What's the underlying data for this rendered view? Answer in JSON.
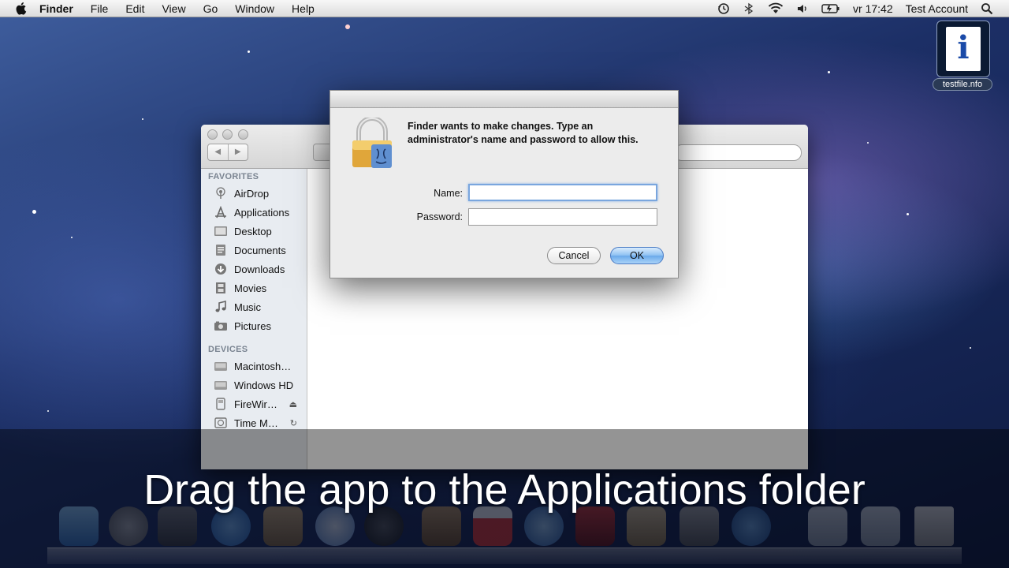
{
  "menubar": {
    "items": [
      "Finder",
      "File",
      "Edit",
      "View",
      "Go",
      "Window",
      "Help"
    ],
    "clock": "vr 17:42",
    "user": "Test Account"
  },
  "badge": {
    "label": "testfile.nfo"
  },
  "finder": {
    "sidebar": {
      "favorites_heading": "FAVORITES",
      "favorites": [
        {
          "label": "AirDrop",
          "icon": "airdrop-icon"
        },
        {
          "label": "Applications",
          "icon": "applications-icon"
        },
        {
          "label": "Desktop",
          "icon": "desktop-icon"
        },
        {
          "label": "Documents",
          "icon": "documents-icon"
        },
        {
          "label": "Downloads",
          "icon": "downloads-icon"
        },
        {
          "label": "Movies",
          "icon": "movies-icon"
        },
        {
          "label": "Music",
          "icon": "music-icon"
        },
        {
          "label": "Pictures",
          "icon": "pictures-icon"
        }
      ],
      "devices_heading": "DEVICES",
      "devices": [
        {
          "label": "Macintosh…",
          "icon": "hard-drive-icon"
        },
        {
          "label": "Windows HD",
          "icon": "hard-drive-icon"
        },
        {
          "label": "FireWir…",
          "icon": "external-drive-icon",
          "eject": "⏏"
        },
        {
          "label": "Time M…",
          "icon": "time-machine-icon",
          "eject": "↻"
        }
      ]
    }
  },
  "dialog": {
    "message": "Finder wants to make changes. Type an administrator's name and password to allow this.",
    "name_label": "Name:",
    "name_value": "",
    "password_label": "Password:",
    "password_value": "",
    "cancel_label": "Cancel",
    "ok_label": "OK"
  },
  "caption": "Drag the app to the Applications folder"
}
